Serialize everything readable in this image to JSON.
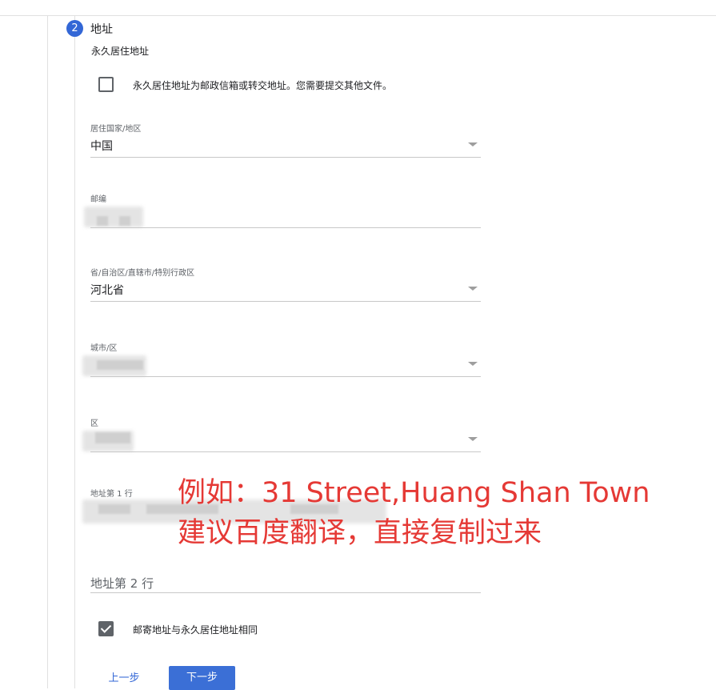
{
  "step": {
    "number": "2",
    "title": "地址"
  },
  "permanent_address": {
    "section_title": "永久居住地址",
    "po_box_checkbox": {
      "label": "永久居住地址为邮政信箱或转交地址。您需要提交其他文件。",
      "checked": false
    }
  },
  "fields": {
    "country": {
      "label": "居住国家/地区",
      "value": "中国"
    },
    "postal_code": {
      "label": "邮编",
      "value": ""
    },
    "province": {
      "label": "省/自治区/直辖市/特别行政区",
      "value": "河北省"
    },
    "city": {
      "label": "城市/区",
      "value": ""
    },
    "district": {
      "label": "区",
      "value": ""
    },
    "address_line1": {
      "label": "地址第 1 行",
      "value": ""
    },
    "address_line2": {
      "placeholder": "地址第 2 行"
    }
  },
  "mailing_same_checkbox": {
    "label": "邮寄地址与永久居住地址相同",
    "checked": true
  },
  "annotation": {
    "line1": "例如：31 Street,Huang Shan Town",
    "line2": "建议百度翻译，直接复制过来",
    "color": "#e53935"
  },
  "buttons": {
    "prev_label": "上一步",
    "next_label": "下一步"
  },
  "colors": {
    "accent": "#3367d6",
    "text": "#202124",
    "muted": "#5f6368",
    "divider": "#e0e0e0"
  }
}
